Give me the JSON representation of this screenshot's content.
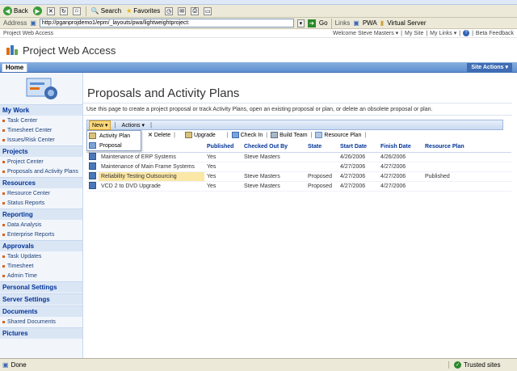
{
  "browser": {
    "toolbar": {
      "back": "Back",
      "search": "Search",
      "favorites": "Favorites"
    },
    "address": {
      "label": "Address",
      "url": "http://pganprojdemo1/epm/_layouts/pwa/lightweightproject: ",
      "go": "Go",
      "links": "Links",
      "link1": "PWA",
      "link2": "Virtual Server"
    },
    "status": {
      "left": "Done",
      "right": "Trusted sites"
    }
  },
  "site": {
    "header_left": "Project Web Access",
    "welcome": "Welcome Steve Masters ▾",
    "my_site": "My Site",
    "my_links": "My Links ▾",
    "beta": "Beta Feedback",
    "title": "Project Web Access",
    "home_tab": "Home",
    "site_actions": "Site Actions ▾"
  },
  "leftnav": {
    "sections": [
      {
        "head": "My Work",
        "items": [
          "Task Center",
          "Timesheet Center",
          "Issues/Risk Center"
        ]
      },
      {
        "head": "Projects",
        "items": [
          "Project Center",
          "Proposals and Activity Plans"
        ]
      },
      {
        "head": "Resources",
        "items": [
          "Resource Center",
          "Status Reports"
        ]
      },
      {
        "head": "Reporting",
        "items": [
          "Data Analysis",
          "Enterprise Reports"
        ]
      },
      {
        "head": "Approvals",
        "items": [
          "Task Updates",
          "Timesheet",
          "Admin Time"
        ]
      },
      {
        "head": "Personal Settings",
        "items": []
      },
      {
        "head": "Server Settings",
        "items": []
      },
      {
        "head": "Documents",
        "items": [
          "Shared Documents"
        ]
      },
      {
        "head": "Pictures",
        "items": []
      }
    ]
  },
  "main": {
    "title": "Proposals and Activity Plans",
    "description": "Use this page to create a project proposal or track Activity Plans, open an existing proposal or plan, or delete an obsolete proposal or plan.",
    "menu": {
      "new": "New ▾",
      "actions": "Actions ▾"
    },
    "dropdown": [
      "Activity Plan",
      "Proposal"
    ],
    "toolbar": [
      "Delete",
      "Upgrade",
      "Check In",
      "Build Team",
      "Resource Plan"
    ],
    "columns": [
      "Name",
      "Published",
      "Checked Out By",
      "State",
      "Start Date",
      "Finish Date",
      "Resource Plan"
    ],
    "rows": [
      {
        "name": "Maintenance of ERP Systems",
        "published": "Yes",
        "checked_out_by": "Steve Masters",
        "state": "",
        "start": "4/26/2006",
        "finish": "4/26/2006",
        "resource_plan": ""
      },
      {
        "name": "Maintenance of Main Frame Systems",
        "published": "Yes",
        "checked_out_by": "",
        "state": "",
        "start": "4/27/2006",
        "finish": "4/27/2006",
        "resource_plan": ""
      },
      {
        "name": "Reliability Testing Outsourcing",
        "published": "Yes",
        "checked_out_by": "Steve Masters",
        "state": "Proposed",
        "start": "4/27/2006",
        "finish": "4/27/2006",
        "resource_plan": "Published"
      },
      {
        "name": "VCD 2 to DVD Upgrade",
        "published": "Yes",
        "checked_out_by": "Steve Masters",
        "state": "Proposed",
        "start": "4/27/2006",
        "finish": "4/27/2006",
        "resource_plan": ""
      }
    ]
  }
}
